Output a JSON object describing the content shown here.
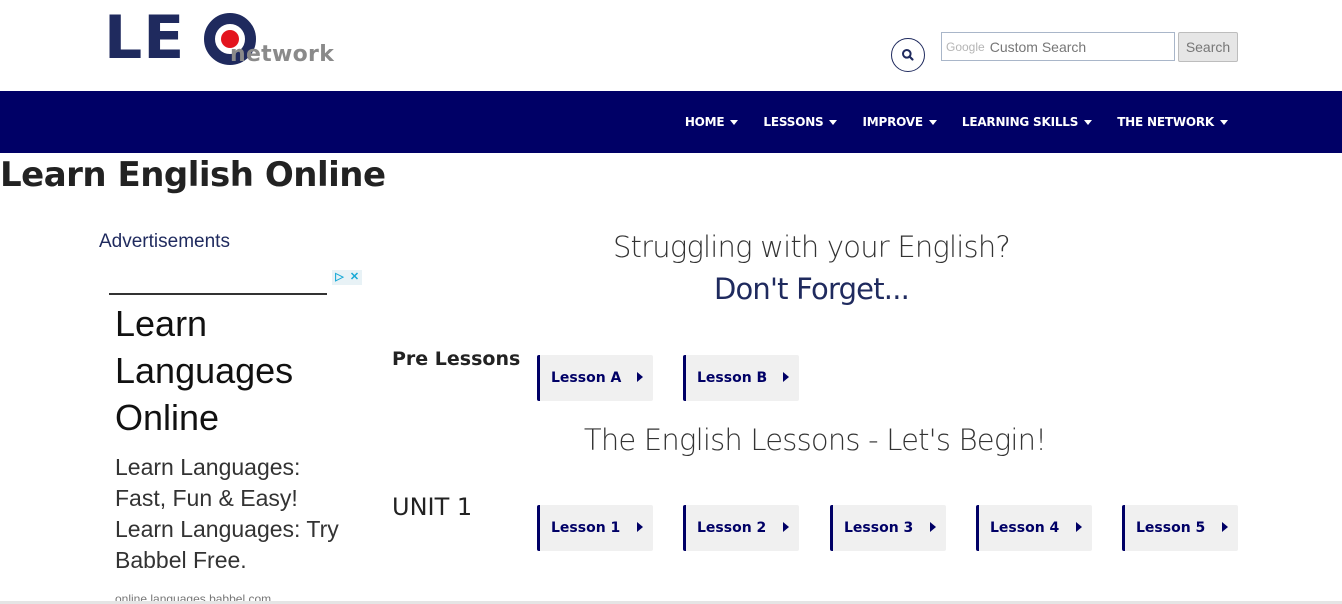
{
  "header": {
    "logo_main": "LE",
    "logo_sub": "network",
    "search_brand": "Google",
    "search_placeholder": "Custom Search",
    "search_button": "Search"
  },
  "nav": {
    "items": [
      {
        "label": "HOME"
      },
      {
        "label": "LESSONS"
      },
      {
        "label": "IMPROVE"
      },
      {
        "label": "LEARNING SKILLS"
      },
      {
        "label": "THE NETWORK"
      }
    ]
  },
  "page": {
    "title": "Learn English Online"
  },
  "ads": {
    "label": "Advertisements",
    "choices_icons": [
      "ad-choices-icon",
      "close-icon"
    ],
    "headline": "Learn Languages Online",
    "body": "Learn Languages: Fast, Fun & Easy! Learn Languages: Try Babbel Free.",
    "url": "online.languages.babbel.com"
  },
  "main": {
    "heading1": "Struggling with your English?",
    "heading2": "Don't Forget...",
    "pre_label": "Pre Lessons",
    "pre_lessons": [
      {
        "label": "Lesson A"
      },
      {
        "label": "Lesson B"
      }
    ],
    "heading3": "The English Lessons - Let's Begin!",
    "unit_label": "UNIT 1",
    "unit_lessons": [
      {
        "label": "Lesson 1"
      },
      {
        "label": "Lesson 2"
      },
      {
        "label": "Lesson 3"
      },
      {
        "label": "Lesson 4"
      },
      {
        "label": "Lesson 5"
      }
    ]
  },
  "colors": {
    "brand_navy": "#000066",
    "logo_navy": "#1f2a5e",
    "logo_red": "#e3141e"
  }
}
